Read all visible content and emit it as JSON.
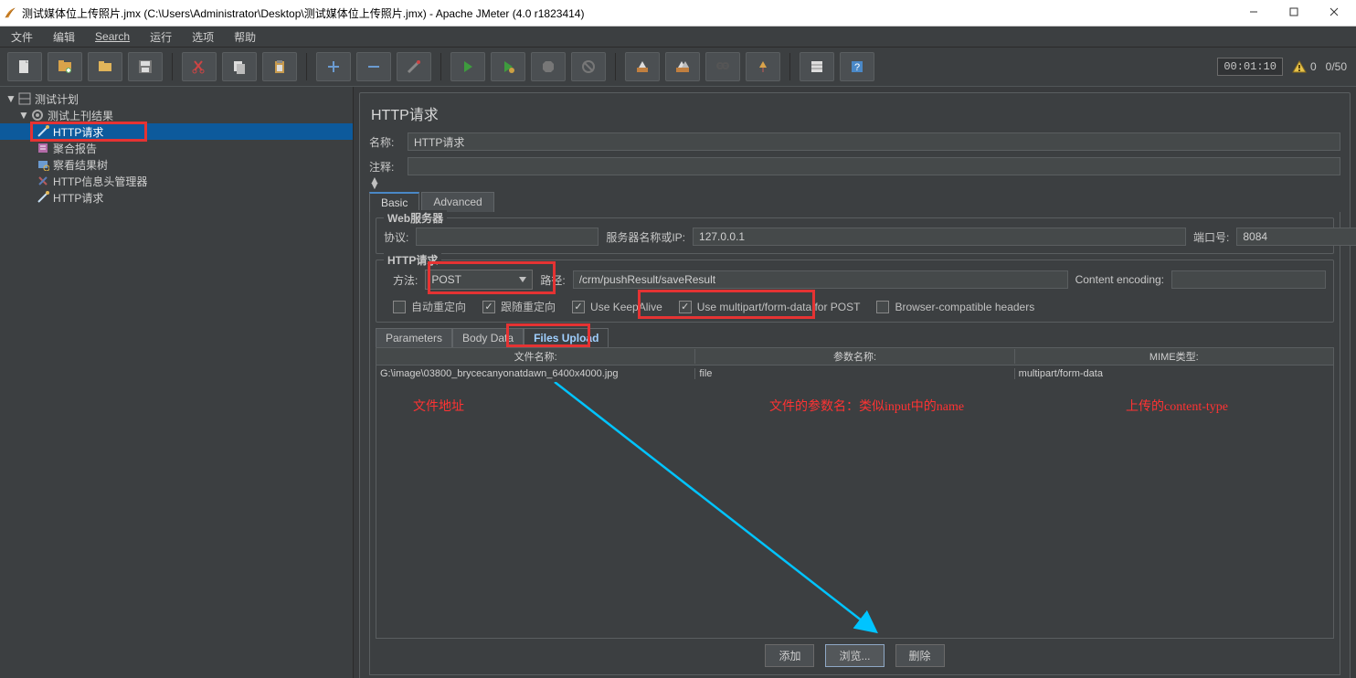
{
  "window": {
    "title": "测试媒体位上传照片.jmx (C:\\Users\\Administrator\\Desktop\\测试媒体位上传照片.jmx) - Apache JMeter (4.0 r1823414)"
  },
  "menu": {
    "file": "文件",
    "edit": "编辑",
    "search": "Search",
    "run": "运行",
    "options": "选项",
    "help": "帮助"
  },
  "toolbar_status": {
    "time": "00:01:10",
    "warn_count": "0",
    "threads": "0/50"
  },
  "tree": {
    "root": "测试计划",
    "tg": "测试上刊结果",
    "http": "HTTP请求",
    "agg": "聚合报告",
    "view": "察看结果树",
    "hdr": "HTTP信息头管理器",
    "http2": "HTTP请求"
  },
  "panel": {
    "title": "HTTP请求",
    "name_lbl": "名称:",
    "name_val": "HTTP请求",
    "comment_lbl": "注释:",
    "comment_val": "",
    "tab_basic": "Basic",
    "tab_adv": "Advanced",
    "web": {
      "title": "Web服务器",
      "proto_lbl": "协议:",
      "proto_val": "",
      "server_lbl": "服务器名称或IP:",
      "server_val": "127.0.0.1",
      "port_lbl": "端口号:",
      "port_val": "8084"
    },
    "http": {
      "title": "HTTP请求",
      "method_lbl": "方法:",
      "method_val": "POST",
      "path_lbl": "路径:",
      "path_val": "/crm/pushResult/saveResult",
      "enc_lbl": "Content encoding:",
      "enc_val": ""
    },
    "chks": {
      "auto_redirect": "自动重定向",
      "follow_redirect": "跟随重定向",
      "keepalive": "Use KeepAlive",
      "multipart": "Use multipart/form-data for POST",
      "browser_compat": "Browser-compatible headers"
    },
    "subtabs": {
      "params": "Parameters",
      "body": "Body Data",
      "files": "Files Upload"
    },
    "table": {
      "h1": "文件名称:",
      "h2": "参数名称:",
      "h3": "MIME类型:",
      "r1c1": "G:\\image\\03800_brycecanyonatdawn_6400x4000.jpg",
      "r1c2": "file",
      "r1c3": "multipart/form-data"
    },
    "annotations": {
      "a1": "文件地址",
      "a2": "文件的参数名：类似input中的name",
      "a3": "上传的content-type"
    },
    "buttons": {
      "add": "添加",
      "browse": "浏览...",
      "delete": "删除"
    }
  }
}
